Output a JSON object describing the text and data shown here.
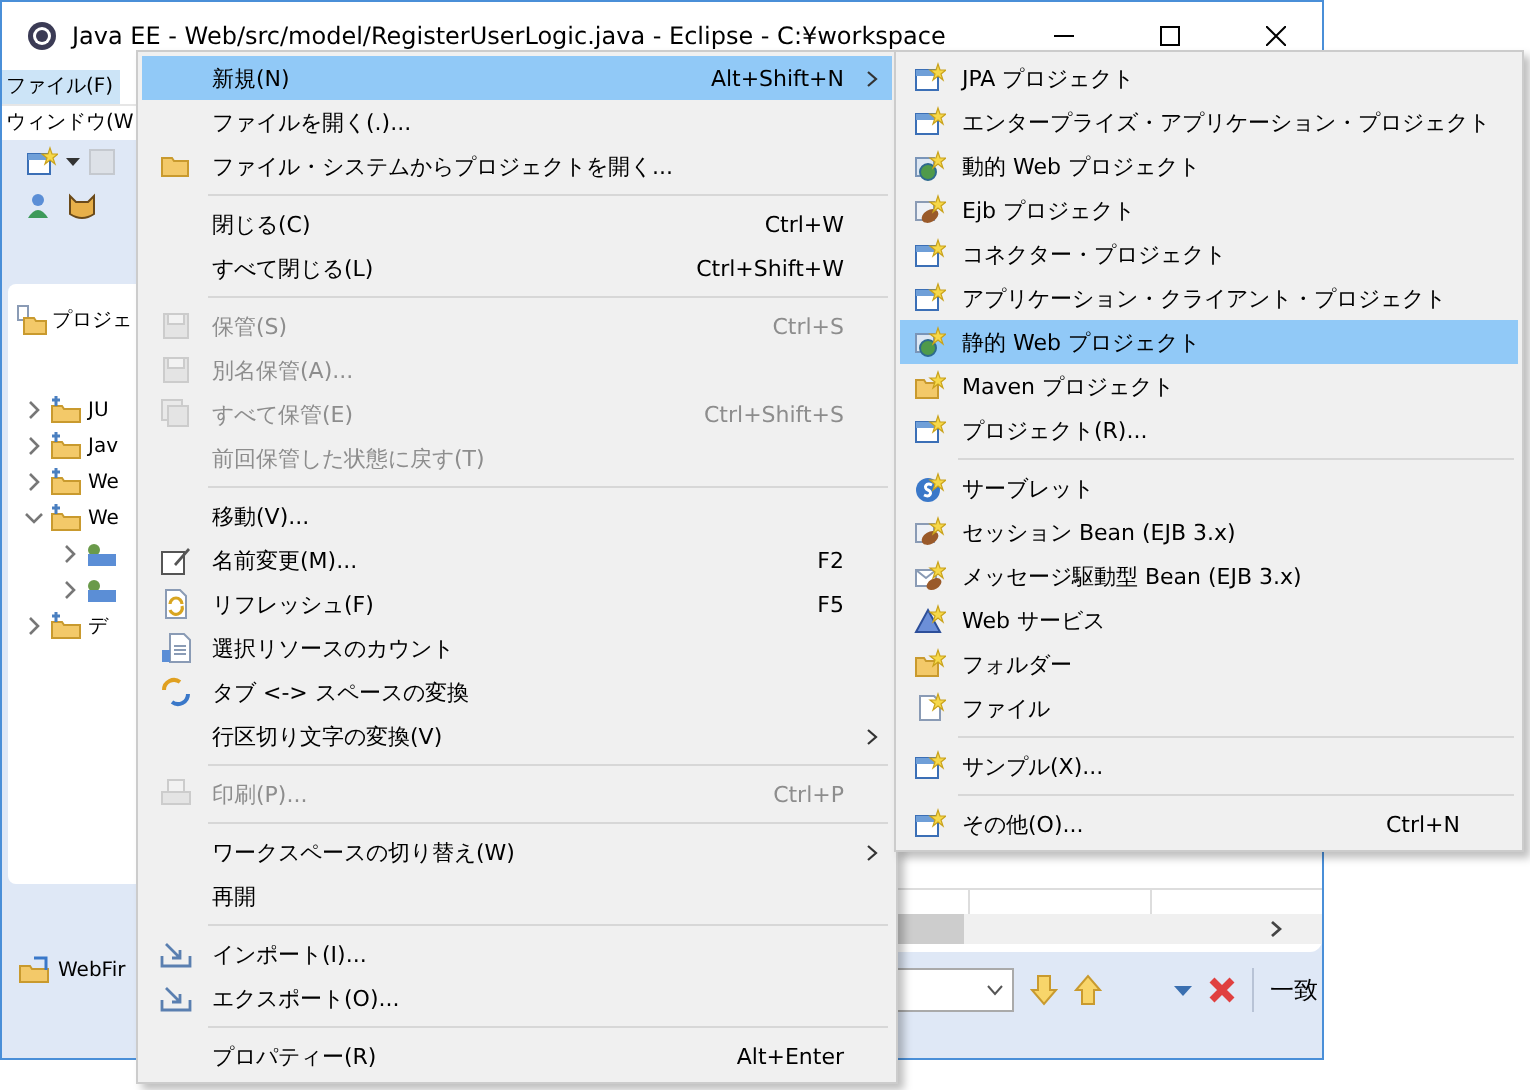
{
  "window": {
    "title": "Java EE - Web/src/model/RegisterUserLogic.java - Eclipse - C:¥workspace"
  },
  "menubar": {
    "rows": [
      [
        {
          "label": "ファイル(F)",
          "selected": true
        }
      ],
      [
        {
          "label": "ウィンドウ(W",
          "selected": false
        }
      ]
    ]
  },
  "project_explorer": {
    "tab": "プロジェ",
    "tree": [
      {
        "label": "JU",
        "expanded": false
      },
      {
        "label": "Jav",
        "expanded": false
      },
      {
        "label": "We",
        "expanded": false
      },
      {
        "label": "We",
        "expanded": true,
        "children": [
          {
            "expanded": false
          },
          {
            "expanded": false
          }
        ]
      },
      {
        "label": "デ",
        "expanded": false
      }
    ]
  },
  "status_item": {
    "label": "WebFir"
  },
  "search_bar": {
    "match_label": "一致"
  },
  "file_menu": {
    "items": [
      {
        "kind": "item",
        "label": "新規(N)",
        "shortcut": "Alt+Shift+N",
        "submenu": true,
        "disabled": false,
        "selected": true
      },
      {
        "kind": "item",
        "label": "ファイルを開く(.)...",
        "submenu": false,
        "disabled": false,
        "selected": false
      },
      {
        "kind": "item",
        "label": "ファイル・システムからプロジェクトを開く...",
        "submenu": false,
        "disabled": false,
        "selected": false
      },
      {
        "kind": "separator"
      },
      {
        "kind": "item",
        "label": "閉じる(C)",
        "shortcut": "Ctrl+W",
        "submenu": false,
        "disabled": false,
        "selected": false
      },
      {
        "kind": "item",
        "label": "すべて閉じる(L)",
        "shortcut": "Ctrl+Shift+W",
        "submenu": false,
        "disabled": false,
        "selected": false
      },
      {
        "kind": "separator"
      },
      {
        "kind": "item",
        "label": "保管(S)",
        "shortcut": "Ctrl+S",
        "submenu": false,
        "disabled": true,
        "selected": false
      },
      {
        "kind": "item",
        "label": "別名保管(A)...",
        "submenu": false,
        "disabled": true,
        "selected": false
      },
      {
        "kind": "item",
        "label": "すべて保管(E)",
        "shortcut": "Ctrl+Shift+S",
        "submenu": false,
        "disabled": true,
        "selected": false
      },
      {
        "kind": "item",
        "label": "前回保管した状態に戻す(T)",
        "submenu": false,
        "disabled": true,
        "selected": false
      },
      {
        "kind": "separator"
      },
      {
        "kind": "item",
        "label": "移動(V)...",
        "submenu": false,
        "disabled": false,
        "selected": false
      },
      {
        "kind": "item",
        "label": "名前変更(M)...",
        "shortcut": "F2",
        "submenu": false,
        "disabled": false,
        "selected": false
      },
      {
        "kind": "item",
        "label": "リフレッシュ(F)",
        "shortcut": "F5",
        "submenu": false,
        "disabled": false,
        "selected": false
      },
      {
        "kind": "item",
        "label": "選択リソースのカウント",
        "submenu": false,
        "disabled": false,
        "selected": false
      },
      {
        "kind": "item",
        "label": "タブ <-> スペースの変換",
        "submenu": false,
        "disabled": false,
        "selected": false
      },
      {
        "kind": "item",
        "label": "行区切り文字の変換(V)",
        "submenu": true,
        "disabled": false,
        "selected": false
      },
      {
        "kind": "separator"
      },
      {
        "kind": "item",
        "label": "印刷(P)...",
        "shortcut": "Ctrl+P",
        "submenu": false,
        "disabled": true,
        "selected": false
      },
      {
        "kind": "separator"
      },
      {
        "kind": "item",
        "label": "ワークスペースの切り替え(W)",
        "submenu": true,
        "disabled": false,
        "selected": false
      },
      {
        "kind": "item",
        "label": "再開",
        "submenu": false,
        "disabled": false,
        "selected": false
      },
      {
        "kind": "separator"
      },
      {
        "kind": "item",
        "label": "インポート(I)...",
        "submenu": false,
        "disabled": false,
        "selected": false
      },
      {
        "kind": "item",
        "label": "エクスポート(O)...",
        "submenu": false,
        "disabled": false,
        "selected": false
      },
      {
        "kind": "separator"
      },
      {
        "kind": "item",
        "label": "プロパティー(R)",
        "shortcut": "Alt+Enter",
        "submenu": false,
        "disabled": false,
        "selected": false
      }
    ]
  },
  "new_submenu": {
    "items": [
      {
        "kind": "item",
        "label": "JPA プロジェクト",
        "selected": false
      },
      {
        "kind": "item",
        "label": "エンタープライズ・アプリケーション・プロジェクト",
        "selected": false
      },
      {
        "kind": "item",
        "label": "動的 Web プロジェクト",
        "selected": false
      },
      {
        "kind": "item",
        "label": "Ejb プロジェクト",
        "selected": false
      },
      {
        "kind": "item",
        "label": "コネクター・プロジェクト",
        "selected": false
      },
      {
        "kind": "item",
        "label": "アプリケーション・クライアント・プロジェクト",
        "selected": false
      },
      {
        "kind": "item",
        "label": "静的 Web プロジェクト",
        "selected": true
      },
      {
        "kind": "item",
        "label": "Maven プロジェクト",
        "selected": false
      },
      {
        "kind": "item",
        "label": "プロジェクト(R)...",
        "selected": false
      },
      {
        "kind": "separator"
      },
      {
        "kind": "item",
        "label": "サーブレット",
        "selected": false
      },
      {
        "kind": "item",
        "label": "セッション Bean (EJB 3.x)",
        "selected": false
      },
      {
        "kind": "item",
        "label": "メッセージ駆動型 Bean (EJB 3.x)",
        "selected": false
      },
      {
        "kind": "item",
        "label": "Web サービス",
        "selected": false
      },
      {
        "kind": "item",
        "label": "フォルダー",
        "selected": false
      },
      {
        "kind": "item",
        "label": "ファイル",
        "selected": false
      },
      {
        "kind": "separator"
      },
      {
        "kind": "item",
        "label": "サンプル(X)...",
        "selected": false
      },
      {
        "kind": "separator"
      },
      {
        "kind": "item",
        "label": "その他(O)...",
        "shortcut": "Ctrl+N",
        "selected": false
      }
    ]
  }
}
